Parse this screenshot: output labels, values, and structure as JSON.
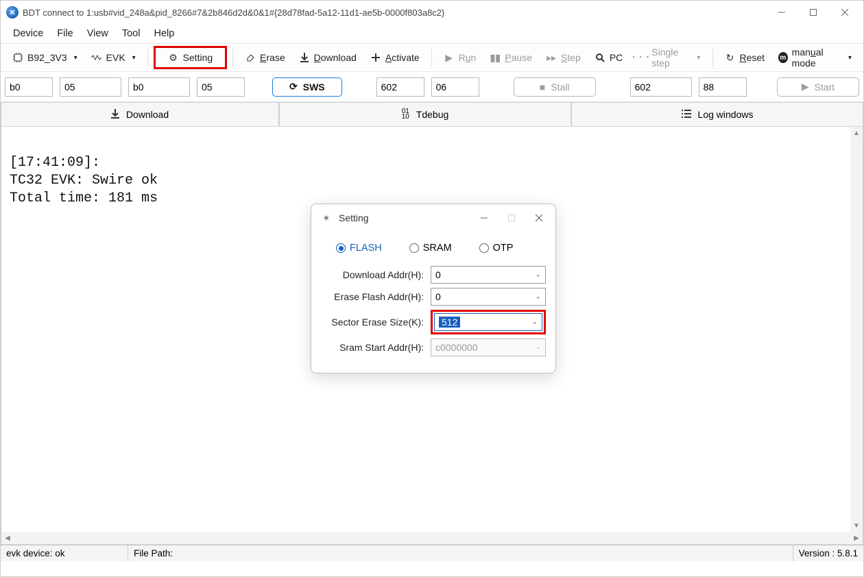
{
  "title": "BDT connect to 1:usb#vid_248a&pid_8266#7&2b846d2d&0&1#{28d78fad-5a12-11d1-ae5b-0000f803a8c2}",
  "menu": [
    "Device",
    "File",
    "View",
    "Tool",
    "Help"
  ],
  "toolbar": {
    "chip": "B92_3V3",
    "evk": "EVK",
    "setting": "Setting",
    "erase": "Erase",
    "download": "Download",
    "activate": "Activate",
    "run": "Run",
    "pause": "Pause",
    "step": "Step",
    "pc": "PC",
    "single": "Single step",
    "reset": "Reset",
    "manual": "manual mode"
  },
  "inputs": {
    "a": "b0",
    "b": "05",
    "c": "b0",
    "d": "05",
    "sws": "SWS",
    "e": "602",
    "f": "06",
    "stall": "Stall",
    "g": "602",
    "h": "88",
    "start": "Start"
  },
  "tabs": {
    "download": "Download",
    "tdebug": "Tdebug",
    "log": "Log windows"
  },
  "console": "\n[17:41:09]:\nTC32 EVK: Swire ok\nTotal time: 181 ms",
  "status": {
    "left": "evk device: ok",
    "mid": "File Path:",
    "ver": "Version : 5.8.1"
  },
  "dialog": {
    "title": "Setting",
    "radios": [
      "FLASH",
      "SRAM",
      "OTP"
    ],
    "rows": [
      {
        "label": "Download  Addr(H):",
        "value": "0",
        "cls": ""
      },
      {
        "label": "Erase Flash Addr(H):",
        "value": "0",
        "cls": ""
      },
      {
        "label": "Sector Erase Size(K):",
        "value": "512",
        "cls": "highlight"
      },
      {
        "label": "Sram Start Addr(H):",
        "value": "c0000000",
        "cls": "disabled"
      }
    ]
  }
}
